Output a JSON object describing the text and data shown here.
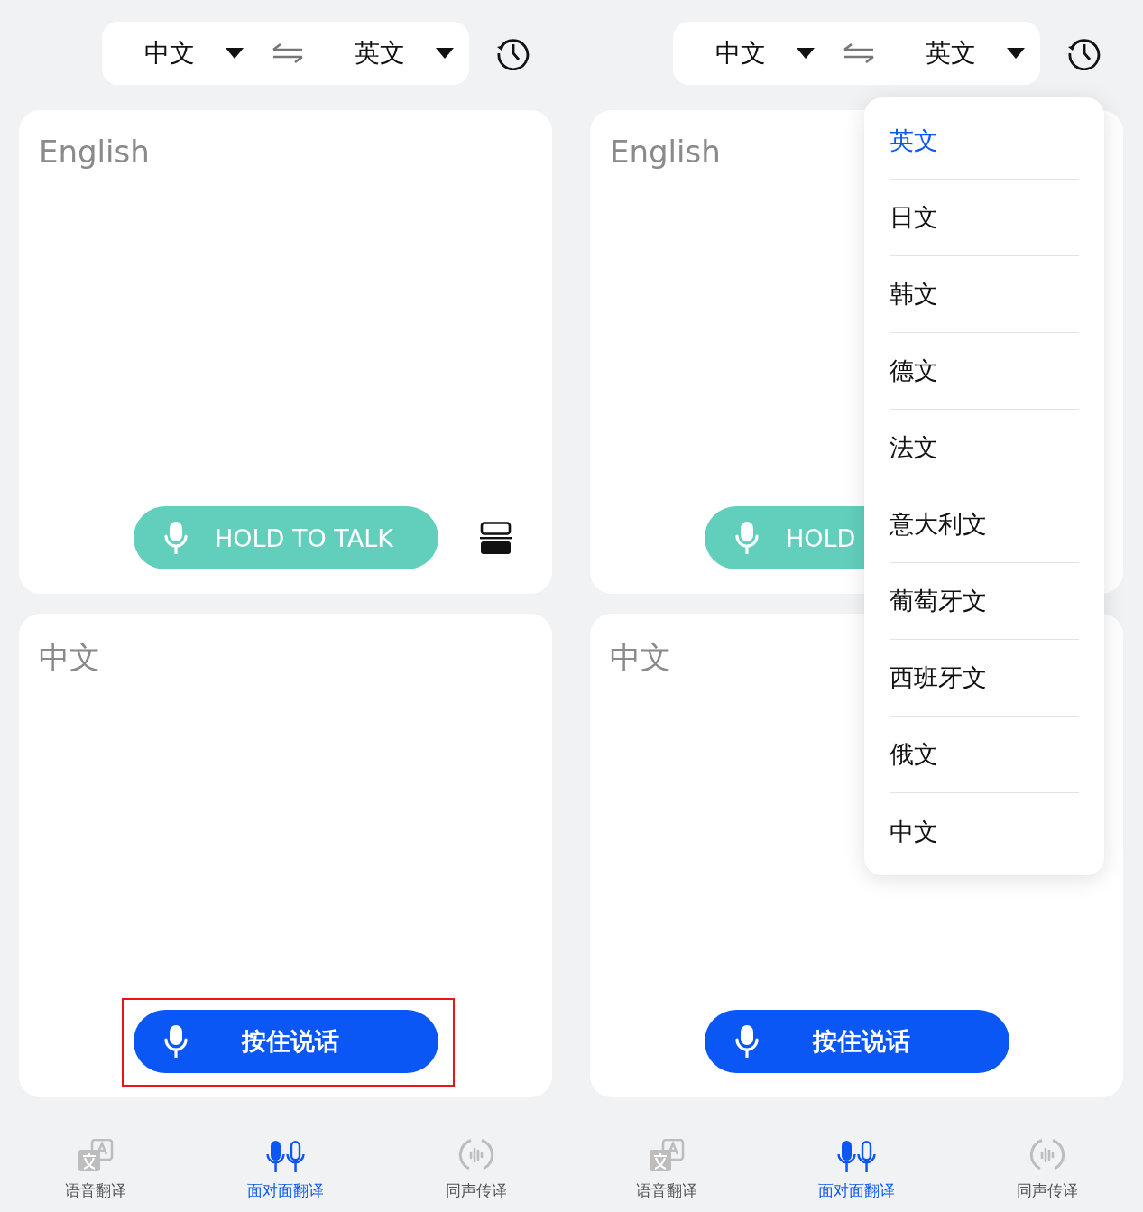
{
  "panes": [
    {
      "source_language": "中文",
      "target_language": "英文",
      "top_card": {
        "placeholder": "English",
        "button": {
          "label": "HOLD TO TALK",
          "highlighted": false
        },
        "layout_toggle": true
      },
      "bottom_card": {
        "placeholder": "中文",
        "button": {
          "label": "按住说话",
          "highlighted": true
        }
      },
      "tabs": [
        {
          "label": "语音翻译",
          "selected": false
        },
        {
          "label": "面对面翻译",
          "selected": true
        },
        {
          "label": "同声传译",
          "selected": false
        }
      ]
    },
    {
      "source_language": "中文",
      "target_language": "英文",
      "top_card": {
        "placeholder": "English",
        "button": {
          "label": "HOLD",
          "highlighted": false
        }
      },
      "bottom_card": {
        "placeholder": "中文",
        "button": {
          "label": "按住说话",
          "highlighted": false
        }
      },
      "tabs": [
        {
          "label": "语音翻译",
          "selected": false
        },
        {
          "label": "面对面翻译",
          "selected": true
        },
        {
          "label": "同声传译",
          "selected": false
        }
      ],
      "language_menu": [
        {
          "label": "英文",
          "selected": true
        },
        {
          "label": "日文",
          "selected": false
        },
        {
          "label": "韩文",
          "selected": false
        },
        {
          "label": "德文",
          "selected": false
        },
        {
          "label": "法文",
          "selected": false
        },
        {
          "label": "意大利文",
          "selected": false
        },
        {
          "label": "葡萄牙文",
          "selected": false
        },
        {
          "label": "西班牙文",
          "selected": false
        },
        {
          "label": "俄文",
          "selected": false
        },
        {
          "label": "中文",
          "selected": false
        }
      ]
    }
  ]
}
